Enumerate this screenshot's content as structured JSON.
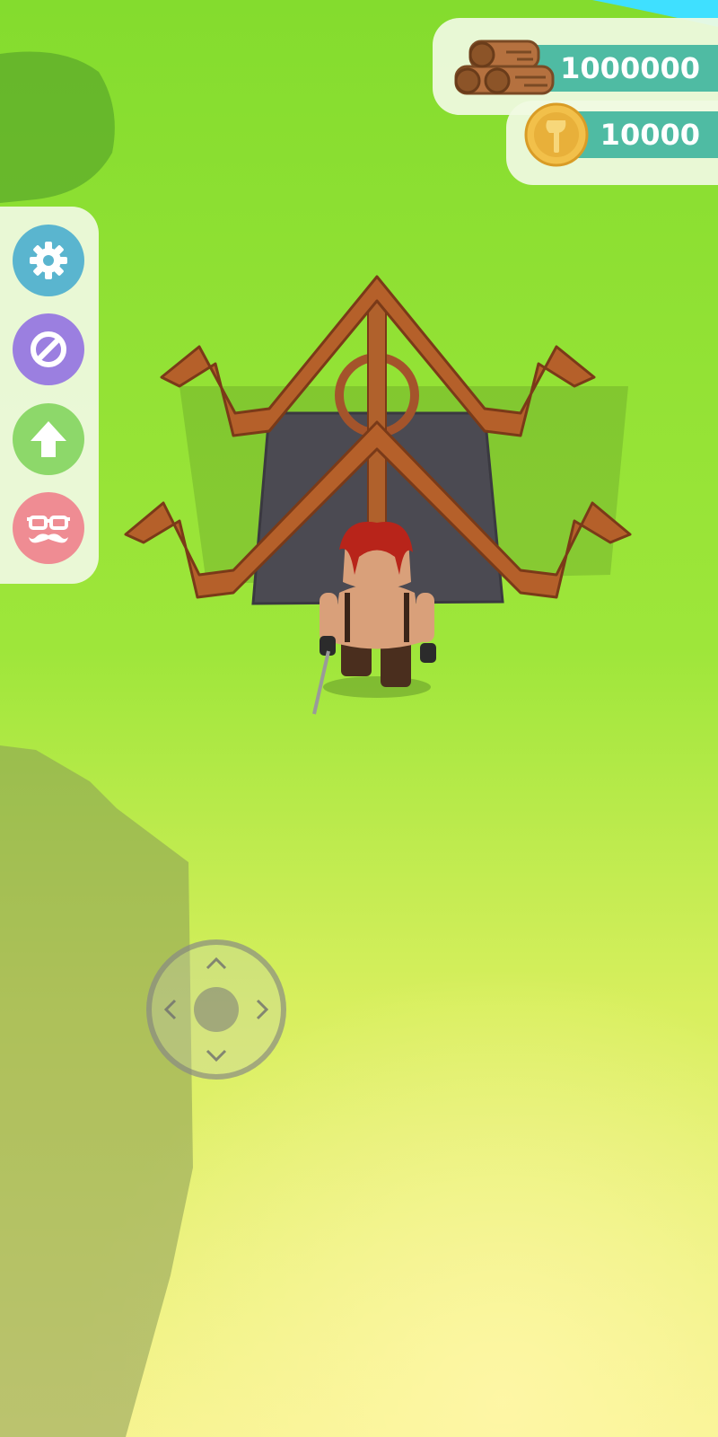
{
  "resources": {
    "wood": {
      "icon": "wood-logs-icon",
      "value": "1000000"
    },
    "coins": {
      "icon": "axe-coin-icon",
      "value": "10000"
    }
  },
  "menu": [
    {
      "name": "settings",
      "icon": "gear-icon",
      "color": "#5ab5cf"
    },
    {
      "name": "no-ads",
      "icon": "no-ads-icon",
      "color": "#9b7fe0"
    },
    {
      "name": "upgrade",
      "icon": "arrow-up-icon",
      "color": "#8dd86a"
    },
    {
      "name": "skin",
      "icon": "disguise-icon",
      "color": "#ef8c93"
    }
  ],
  "joystick": {
    "icon": "dpad-arrows-icon"
  },
  "colors": {
    "panel_bg": "#f0fae2",
    "pill": "#4fbba3",
    "grass": "#8ee03a",
    "wood": "#b5602a"
  }
}
